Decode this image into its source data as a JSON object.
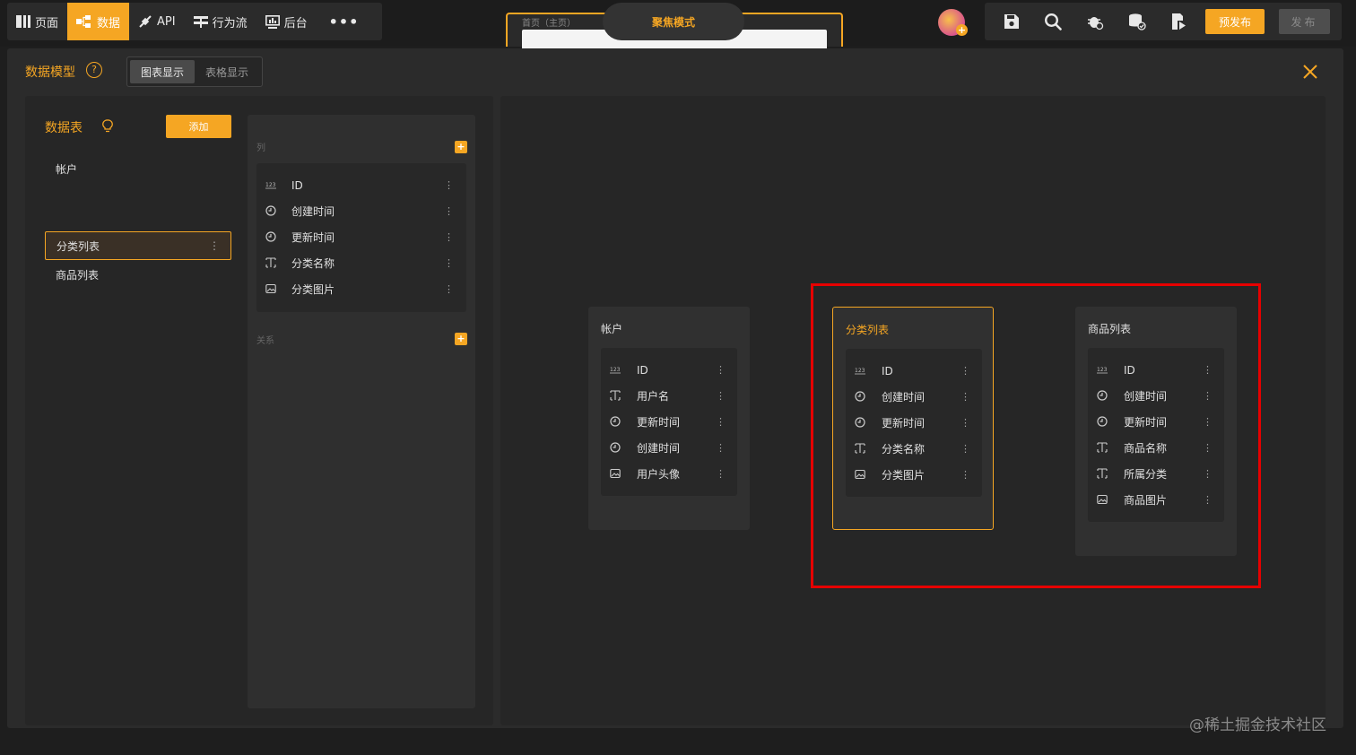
{
  "nav": {
    "items": [
      {
        "label": "页面",
        "icon": "page-icon"
      },
      {
        "label": "数据",
        "icon": "data-icon",
        "active": true
      },
      {
        "label": "API",
        "icon": "api-icon"
      },
      {
        "label": "行为流",
        "icon": "flow-icon"
      },
      {
        "label": "后台",
        "icon": "admin-icon"
      }
    ],
    "more": "•••"
  },
  "focus": {
    "breadcrumb": "首页（主页）",
    "mode_label": "聚焦模式"
  },
  "toolbar": {
    "prepublish_label": "预发布",
    "publish_label": "发布"
  },
  "modal": {
    "title": "数据模型",
    "help": "?",
    "views": [
      "图表显示",
      "表格显示"
    ]
  },
  "tables": {
    "title": "数据表",
    "add_label": "添加",
    "items": [
      "帐户",
      "分类列表",
      "商品列表"
    ],
    "selected": "分类列表"
  },
  "columns": {
    "section_label": "列",
    "relation_label": "关系",
    "fields": [
      {
        "label": "ID",
        "type": "number"
      },
      {
        "label": "创建时间",
        "type": "time"
      },
      {
        "label": "更新时间",
        "type": "time"
      },
      {
        "label": "分类名称",
        "type": "text"
      },
      {
        "label": "分类图片",
        "type": "image"
      }
    ]
  },
  "entities": [
    {
      "title": "帐户",
      "fields": [
        "ID",
        "用户名",
        "更新时间",
        "创建时间",
        "用户头像"
      ],
      "types": [
        "number",
        "text",
        "time",
        "time",
        "image"
      ]
    },
    {
      "title": "分类列表",
      "fields": [
        "ID",
        "创建时间",
        "更新时间",
        "分类名称",
        "分类图片"
      ],
      "types": [
        "number",
        "time",
        "time",
        "text",
        "image"
      ]
    },
    {
      "title": "商品列表",
      "fields": [
        "ID",
        "创建时间",
        "更新时间",
        "商品名称",
        "所属分类",
        "商品图片"
      ],
      "types": [
        "number",
        "time",
        "time",
        "text",
        "text",
        "image"
      ]
    }
  ],
  "watermark": "@稀土掘金技术社区",
  "colors": {
    "accent": "#f5a623",
    "highlight": "#e60000"
  }
}
